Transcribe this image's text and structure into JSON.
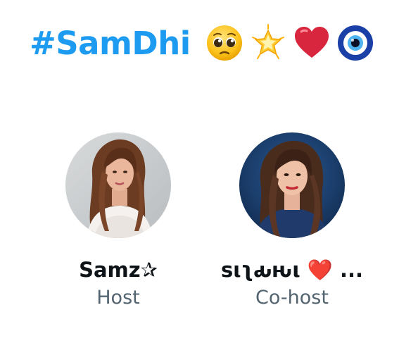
{
  "header": {
    "title": "#SamDhi",
    "emojis": [
      {
        "icon": "pleading-face-icon"
      },
      {
        "icon": "glowing-star-icon"
      },
      {
        "icon": "red-heart-icon"
      },
      {
        "icon": "nazar-amulet-icon"
      }
    ]
  },
  "participants": [
    {
      "name": "Samz✰",
      "role": "Host",
      "avatar": "host-avatar"
    },
    {
      "name": "sιʅԃԋι ❤️ ...",
      "role": "Co-host",
      "avatar": "cohost-avatar"
    }
  ],
  "colors": {
    "accent": "#1d9bf0",
    "name": "#0f1419",
    "secondary": "#536471"
  }
}
